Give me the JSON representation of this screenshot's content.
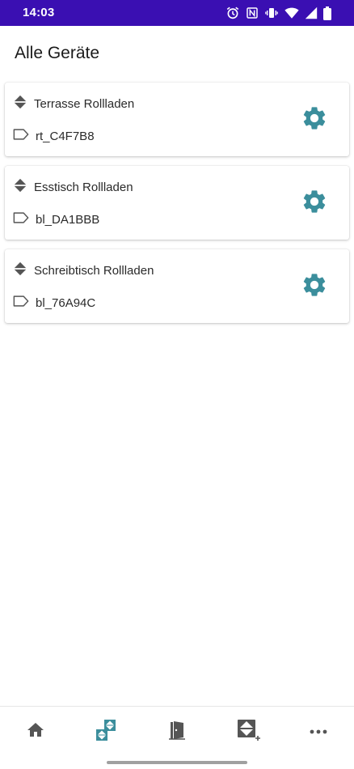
{
  "status_bar": {
    "time": "14:03",
    "icons": [
      "alarm-icon",
      "nfc-icon",
      "vibrate-icon",
      "wifi-icon",
      "signal-icon",
      "battery-icon"
    ]
  },
  "page": {
    "title": "Alle Geräte"
  },
  "devices": [
    {
      "name": "Terrasse Rollladen",
      "id": "rt_C4F7B8"
    },
    {
      "name": "Esstisch Rollladen",
      "id": "bl_DA1BBB"
    },
    {
      "name": "Schreibtisch Rollladen",
      "id": "bl_76A94C"
    }
  ],
  "bottom_nav": {
    "items": [
      "home-icon",
      "devices-icon",
      "door-icon",
      "add-device-icon",
      "more-icon"
    ],
    "active": "devices-icon"
  },
  "colors": {
    "status_bar": "#3a0fb2",
    "accent": "#3b8e9c",
    "icon_gray": "#555555"
  }
}
